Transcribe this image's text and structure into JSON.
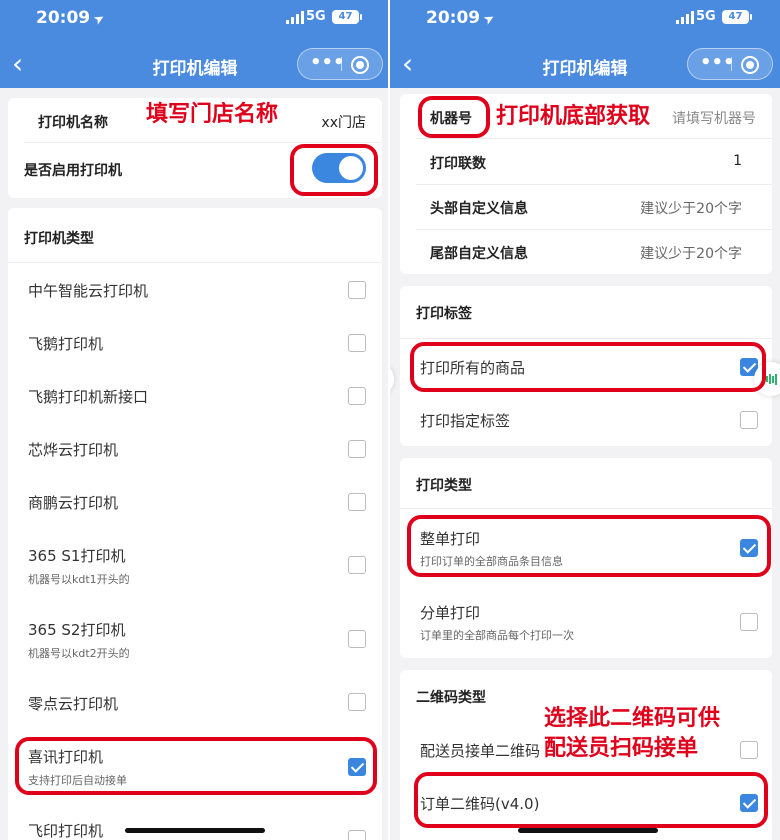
{
  "status": {
    "time": "20:09",
    "network": "5G",
    "battery": "47"
  },
  "nav": {
    "title": "打印机编辑",
    "more_icon": "ellipsis-icon",
    "close_icon": "target-icon"
  },
  "left": {
    "printer_name": {
      "label": "打印机名称",
      "value": "xx门店"
    },
    "enable": {
      "label": "是否启用打印机",
      "on": true
    },
    "type_header": "打印机类型",
    "types": [
      {
        "label": "中午智能云打印机",
        "sub": "",
        "checked": false
      },
      {
        "label": "飞鹅打印机",
        "sub": "",
        "checked": false
      },
      {
        "label": "飞鹅打印机新接口",
        "sub": "",
        "checked": false
      },
      {
        "label": "芯烨云打印机",
        "sub": "",
        "checked": false
      },
      {
        "label": "商鹏云打印机",
        "sub": "",
        "checked": false
      },
      {
        "label": "365 S1打印机",
        "sub": "机器号以kdt1开头的",
        "checked": false
      },
      {
        "label": "365 S2打印机",
        "sub": "机器号以kdt2开头的",
        "checked": false
      },
      {
        "label": "零点云打印机",
        "sub": "",
        "checked": false
      },
      {
        "label": "喜讯打印机",
        "sub": "支持打印后自动接单",
        "checked": true
      },
      {
        "label": "飞印打印机",
        "sub": "",
        "checked": false
      }
    ],
    "annotation": "填写门店名称"
  },
  "right": {
    "machine_no": {
      "label": "机器号",
      "placeholder": "请填写机器号"
    },
    "copies": {
      "label": "打印联数",
      "value": "1"
    },
    "header_info": {
      "label": "头部自定义信息",
      "placeholder": "建议少于20个字"
    },
    "footer_info": {
      "label": "尾部自定义信息",
      "placeholder": "建议少于20个字"
    },
    "label_header": "打印标签",
    "label_opts": [
      {
        "label": "打印所有的商品",
        "checked": true
      },
      {
        "label": "打印指定标签",
        "checked": false
      }
    ],
    "print_type_header": "打印类型",
    "print_types": [
      {
        "label": "整单打印",
        "sub": "打印订单的全部商品条目信息",
        "checked": true
      },
      {
        "label": "分单打印",
        "sub": "订单里的全部商品每个打印一次",
        "checked": false
      }
    ],
    "qr_header": "二维码类型",
    "qr_opts": [
      {
        "label": "配送员接单二维码",
        "checked": false
      },
      {
        "label": "订单二维码(v4.0)",
        "checked": true
      }
    ],
    "annotation_machine": "打印机底部获取",
    "annotation_qr_1": "选择此二维码可供",
    "annotation_qr_2": "配送员扫码接单"
  },
  "colors": {
    "nav": "#4a8be0",
    "accent": "#3b87e0",
    "annotation": "#e0001b"
  }
}
